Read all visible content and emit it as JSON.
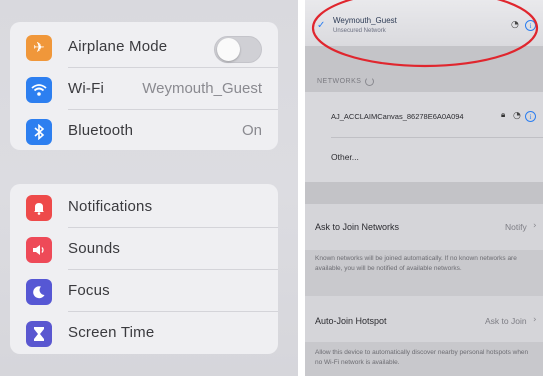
{
  "settings": {
    "group1": [
      {
        "label": "Airplane Mode",
        "icon": "airplane-icon",
        "color": "#f0973a",
        "toggle_on": false
      },
      {
        "label": "Wi-Fi",
        "icon": "wifi-icon",
        "color": "#2d7ff0",
        "value": "Weymouth_Guest"
      },
      {
        "label": "Bluetooth",
        "icon": "bluetooth-icon",
        "color": "#2d7ff0",
        "value": "On"
      }
    ],
    "group2": [
      {
        "label": "Notifications",
        "icon": "bell-icon",
        "color": "#ee4a4a"
      },
      {
        "label": "Sounds",
        "icon": "speaker-icon",
        "color": "#ee4a58"
      },
      {
        "label": "Focus",
        "icon": "moon-icon",
        "color": "#5657d4"
      },
      {
        "label": "Screen Time",
        "icon": "hourglass-icon",
        "color": "#5a57d0"
      }
    ]
  },
  "wifi": {
    "connected": {
      "name": "Weymouth_Guest",
      "status": "Unsecured Network"
    },
    "networks_header": "NETWORKS",
    "networks": [
      {
        "name": "AJ_ACCLAIMCanvas_86278E6A0A094"
      },
      {
        "name": "Other..."
      }
    ],
    "ask_to_join": {
      "label": "Ask to Join Networks",
      "value": "Notify"
    },
    "ask_to_join_note": "Known networks will be joined automatically. If no known networks are available, you will be notified of available networks.",
    "auto_join": {
      "label": "Auto-Join Hotspot",
      "value": "Ask to Join"
    },
    "auto_join_note": "Allow this device to automatically discover nearby personal hotspots when no Wi-Fi network is available."
  },
  "annotation": {
    "shape": "ellipse",
    "color": "#e0262e"
  }
}
